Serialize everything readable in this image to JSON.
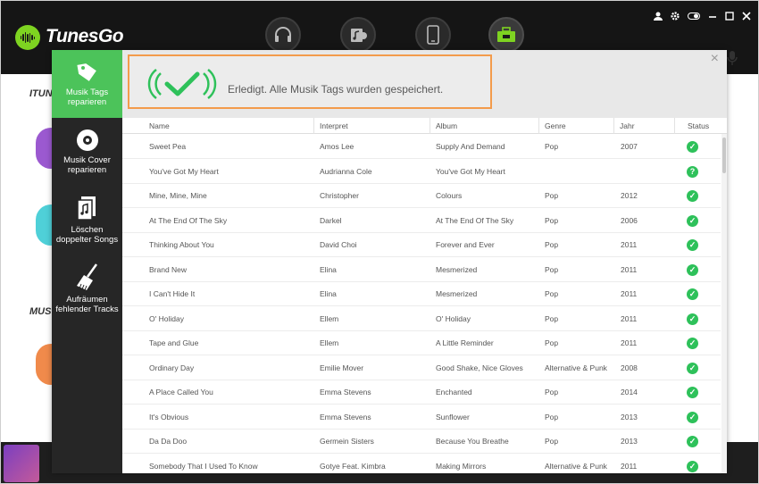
{
  "app": {
    "title": "TunesGo"
  },
  "background": {
    "section1": "ITUN",
    "section2": "MUS"
  },
  "modal": {
    "sidebar": [
      {
        "label": "Musik Tags reparieren",
        "icon": "tag-icon"
      },
      {
        "label": "Musik Cover reparieren",
        "icon": "disc-icon"
      },
      {
        "label": "Löschen doppelter Songs",
        "icon": "duplicate-icon"
      },
      {
        "label": "Aufräumen fehlender Tracks",
        "icon": "broom-icon"
      }
    ],
    "banner": {
      "message": "Erledigt. Alle Musik Tags wurden gespeichert."
    },
    "close_glyph": "×"
  },
  "table": {
    "columns": [
      "Name",
      "Interpret",
      "Album",
      "Genre",
      "Jahr",
      "Status"
    ],
    "rows": [
      {
        "name": "Sweet Pea",
        "artist": "Amos Lee",
        "album": "Supply And Demand",
        "genre": "Pop",
        "year": "2007",
        "status": "ok"
      },
      {
        "name": "You've Got My Heart",
        "artist": "Audrianna Cole",
        "album": "You've Got My Heart",
        "genre": "",
        "year": "",
        "status": "question"
      },
      {
        "name": "Mine, Mine, Mine",
        "artist": "Christopher",
        "album": "Colours",
        "genre": "Pop",
        "year": "2012",
        "status": "ok"
      },
      {
        "name": "At The End Of The Sky",
        "artist": "Darkel",
        "album": "At The End Of The Sky",
        "genre": "Pop",
        "year": "2006",
        "status": "ok"
      },
      {
        "name": "Thinking About You",
        "artist": "David Choi",
        "album": "Forever and Ever",
        "genre": "Pop",
        "year": "2011",
        "status": "ok"
      },
      {
        "name": "Brand New",
        "artist": "Elina",
        "album": "Mesmerized",
        "genre": "Pop",
        "year": "2011",
        "status": "ok"
      },
      {
        "name": "I Can't Hide It",
        "artist": "Elina",
        "album": "Mesmerized",
        "genre": "Pop",
        "year": "2011",
        "status": "ok"
      },
      {
        "name": "O' Holiday",
        "artist": "Ellem",
        "album": "O' Holiday",
        "genre": "Pop",
        "year": "2011",
        "status": "ok"
      },
      {
        "name": "Tape and Glue",
        "artist": "Ellem",
        "album": "A Little Reminder",
        "genre": "Pop",
        "year": "2011",
        "status": "ok"
      },
      {
        "name": "Ordinary Day",
        "artist": "Emilie Mover",
        "album": "Good Shake, Nice Gloves",
        "genre": "Alternative & Punk",
        "year": "2008",
        "status": "ok"
      },
      {
        "name": "A Place Called You",
        "artist": "Emma Stevens",
        "album": "Enchanted",
        "genre": "Pop",
        "year": "2014",
        "status": "ok"
      },
      {
        "name": "It's Obvious",
        "artist": "Emma Stevens",
        "album": "Sunflower",
        "genre": "Pop",
        "year": "2013",
        "status": "ok"
      },
      {
        "name": "Da Da Doo",
        "artist": "Germein Sisters",
        "album": "Because You Breathe",
        "genre": "Pop",
        "year": "2013",
        "status": "ok"
      },
      {
        "name": "Somebody That I Used To Know",
        "artist": "Gotye Feat. Kimbra",
        "album": "Making Mirrors",
        "genre": "Alternative & Punk",
        "year": "2011",
        "status": "ok"
      }
    ]
  },
  "colors": {
    "accent": "#4cc35a",
    "highlight_border": "#f39b4b",
    "status_green": "#2ec15a"
  }
}
